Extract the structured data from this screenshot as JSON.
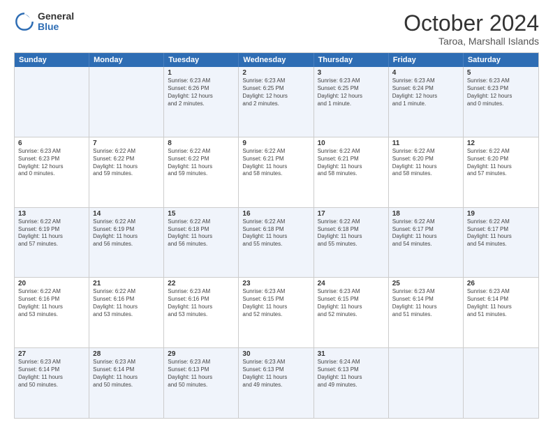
{
  "logo": {
    "general": "General",
    "blue": "Blue"
  },
  "title": "October 2024",
  "subtitle": "Taroa, Marshall Islands",
  "days": [
    "Sunday",
    "Monday",
    "Tuesday",
    "Wednesday",
    "Thursday",
    "Friday",
    "Saturday"
  ],
  "weeks": [
    [
      {
        "num": "",
        "info": ""
      },
      {
        "num": "",
        "info": ""
      },
      {
        "num": "1",
        "info": "Sunrise: 6:23 AM\nSunset: 6:26 PM\nDaylight: 12 hours\nand 2 minutes."
      },
      {
        "num": "2",
        "info": "Sunrise: 6:23 AM\nSunset: 6:25 PM\nDaylight: 12 hours\nand 2 minutes."
      },
      {
        "num": "3",
        "info": "Sunrise: 6:23 AM\nSunset: 6:25 PM\nDaylight: 12 hours\nand 1 minute."
      },
      {
        "num": "4",
        "info": "Sunrise: 6:23 AM\nSunset: 6:24 PM\nDaylight: 12 hours\nand 1 minute."
      },
      {
        "num": "5",
        "info": "Sunrise: 6:23 AM\nSunset: 6:23 PM\nDaylight: 12 hours\nand 0 minutes."
      }
    ],
    [
      {
        "num": "6",
        "info": "Sunrise: 6:23 AM\nSunset: 6:23 PM\nDaylight: 12 hours\nand 0 minutes."
      },
      {
        "num": "7",
        "info": "Sunrise: 6:22 AM\nSunset: 6:22 PM\nDaylight: 11 hours\nand 59 minutes."
      },
      {
        "num": "8",
        "info": "Sunrise: 6:22 AM\nSunset: 6:22 PM\nDaylight: 11 hours\nand 59 minutes."
      },
      {
        "num": "9",
        "info": "Sunrise: 6:22 AM\nSunset: 6:21 PM\nDaylight: 11 hours\nand 58 minutes."
      },
      {
        "num": "10",
        "info": "Sunrise: 6:22 AM\nSunset: 6:21 PM\nDaylight: 11 hours\nand 58 minutes."
      },
      {
        "num": "11",
        "info": "Sunrise: 6:22 AM\nSunset: 6:20 PM\nDaylight: 11 hours\nand 58 minutes."
      },
      {
        "num": "12",
        "info": "Sunrise: 6:22 AM\nSunset: 6:20 PM\nDaylight: 11 hours\nand 57 minutes."
      }
    ],
    [
      {
        "num": "13",
        "info": "Sunrise: 6:22 AM\nSunset: 6:19 PM\nDaylight: 11 hours\nand 57 minutes."
      },
      {
        "num": "14",
        "info": "Sunrise: 6:22 AM\nSunset: 6:19 PM\nDaylight: 11 hours\nand 56 minutes."
      },
      {
        "num": "15",
        "info": "Sunrise: 6:22 AM\nSunset: 6:18 PM\nDaylight: 11 hours\nand 56 minutes."
      },
      {
        "num": "16",
        "info": "Sunrise: 6:22 AM\nSunset: 6:18 PM\nDaylight: 11 hours\nand 55 minutes."
      },
      {
        "num": "17",
        "info": "Sunrise: 6:22 AM\nSunset: 6:18 PM\nDaylight: 11 hours\nand 55 minutes."
      },
      {
        "num": "18",
        "info": "Sunrise: 6:22 AM\nSunset: 6:17 PM\nDaylight: 11 hours\nand 54 minutes."
      },
      {
        "num": "19",
        "info": "Sunrise: 6:22 AM\nSunset: 6:17 PM\nDaylight: 11 hours\nand 54 minutes."
      }
    ],
    [
      {
        "num": "20",
        "info": "Sunrise: 6:22 AM\nSunset: 6:16 PM\nDaylight: 11 hours\nand 53 minutes."
      },
      {
        "num": "21",
        "info": "Sunrise: 6:22 AM\nSunset: 6:16 PM\nDaylight: 11 hours\nand 53 minutes."
      },
      {
        "num": "22",
        "info": "Sunrise: 6:23 AM\nSunset: 6:16 PM\nDaylight: 11 hours\nand 53 minutes."
      },
      {
        "num": "23",
        "info": "Sunrise: 6:23 AM\nSunset: 6:15 PM\nDaylight: 11 hours\nand 52 minutes."
      },
      {
        "num": "24",
        "info": "Sunrise: 6:23 AM\nSunset: 6:15 PM\nDaylight: 11 hours\nand 52 minutes."
      },
      {
        "num": "25",
        "info": "Sunrise: 6:23 AM\nSunset: 6:14 PM\nDaylight: 11 hours\nand 51 minutes."
      },
      {
        "num": "26",
        "info": "Sunrise: 6:23 AM\nSunset: 6:14 PM\nDaylight: 11 hours\nand 51 minutes."
      }
    ],
    [
      {
        "num": "27",
        "info": "Sunrise: 6:23 AM\nSunset: 6:14 PM\nDaylight: 11 hours\nand 50 minutes."
      },
      {
        "num": "28",
        "info": "Sunrise: 6:23 AM\nSunset: 6:14 PM\nDaylight: 11 hours\nand 50 minutes."
      },
      {
        "num": "29",
        "info": "Sunrise: 6:23 AM\nSunset: 6:13 PM\nDaylight: 11 hours\nand 50 minutes."
      },
      {
        "num": "30",
        "info": "Sunrise: 6:23 AM\nSunset: 6:13 PM\nDaylight: 11 hours\nand 49 minutes."
      },
      {
        "num": "31",
        "info": "Sunrise: 6:24 AM\nSunset: 6:13 PM\nDaylight: 11 hours\nand 49 minutes."
      },
      {
        "num": "",
        "info": ""
      },
      {
        "num": "",
        "info": ""
      }
    ]
  ]
}
